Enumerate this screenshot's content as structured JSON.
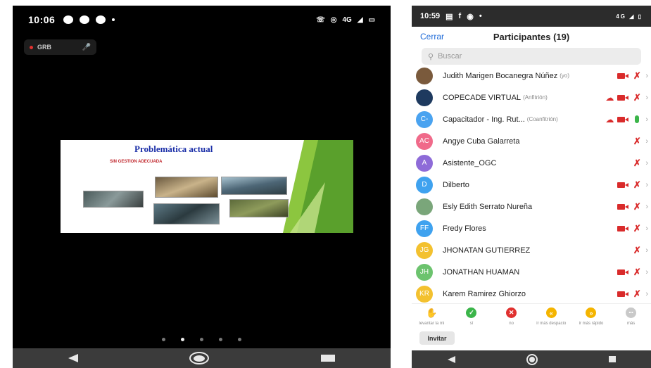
{
  "left_phone": {
    "status": {
      "time": "10:06",
      "network": "4G"
    },
    "recording_label": "GRB",
    "slide": {
      "title": "Problemática actual",
      "subtitle": "SIN GESTION ADECUADA"
    },
    "page_dots": {
      "count": 5,
      "active": 1
    }
  },
  "right_phone": {
    "status": {
      "time": "10:59",
      "network": "4G"
    },
    "header": {
      "close_label": "Cerrar",
      "title": "Participantes (19)"
    },
    "search": {
      "placeholder": "Buscar"
    },
    "participants": [
      {
        "name": "Judith Marigen Bocanegra Núñez",
        "tag": "(yo)",
        "avatar_initials": "",
        "avatar_color": "#7a5a3c",
        "icons": [
          "video-off",
          "mic-off"
        ]
      },
      {
        "name": "COPECADE VIRTUAL",
        "tag": "(Anfitrión)",
        "avatar_initials": "",
        "avatar_color": "#1e3a5f",
        "icons": [
          "cloud",
          "video-off",
          "mic-off"
        ]
      },
      {
        "name": "Capacitador - Ing. Rut...",
        "tag": "(Coanfitrión)",
        "avatar_initials": "C-",
        "avatar_color": "#4aa3f0",
        "icons": [
          "cloud",
          "video-off",
          "mic-on"
        ]
      },
      {
        "name": "Angye Cuba Galarreta",
        "tag": "",
        "avatar_initials": "AC",
        "avatar_color": "#f06a8a",
        "icons": [
          "mic-off"
        ]
      },
      {
        "name": "Asistente_OGC",
        "tag": "",
        "avatar_initials": "A",
        "avatar_color": "#8e6bd8",
        "icons": [
          "mic-off"
        ]
      },
      {
        "name": "Dilberto",
        "tag": "",
        "avatar_initials": "D",
        "avatar_color": "#3fa2ef",
        "icons": [
          "video-off",
          "mic-off"
        ]
      },
      {
        "name": "Esly Edith Serrato Nureña",
        "tag": "",
        "avatar_initials": "",
        "avatar_color": "#7aa67a",
        "icons": [
          "video-off",
          "mic-off"
        ]
      },
      {
        "name": "Fredy Flores",
        "tag": "",
        "avatar_initials": "FF",
        "avatar_color": "#3fa2ef",
        "icons": [
          "video-off",
          "mic-off"
        ]
      },
      {
        "name": "JHONATAN GUTIERREZ",
        "tag": "",
        "avatar_initials": "JG",
        "avatar_color": "#f3c12f",
        "icons": [
          "mic-off"
        ]
      },
      {
        "name": "JONATHAN HUAMAN",
        "tag": "",
        "avatar_initials": "JH",
        "avatar_color": "#6cc36e",
        "icons": [
          "video-off",
          "mic-off"
        ]
      },
      {
        "name": "Karem Ramirez Ghiorzo",
        "tag": "",
        "avatar_initials": "KR",
        "avatar_color": "#f3c12f",
        "icons": [
          "video-off",
          "mic-off"
        ]
      }
    ],
    "actions": [
      {
        "label": "levantar la mi",
        "icon": "hand-icon",
        "color": "#2b63d9",
        "glyph": "✋"
      },
      {
        "label": "sí",
        "icon": "check-icon",
        "color": "#3bb54a",
        "glyph": "✓"
      },
      {
        "label": "no",
        "icon": "x-icon",
        "color": "#e0312f",
        "glyph": "✕"
      },
      {
        "label": "ir más despacio",
        "icon": "rewind-icon",
        "color": "#f4b400",
        "glyph": "«"
      },
      {
        "label": "ir más rápido",
        "icon": "fast-forward-icon",
        "color": "#f4b400",
        "glyph": "»"
      },
      {
        "label": "más",
        "icon": "more-icon",
        "color": "#c9c9c9",
        "glyph": "•••"
      }
    ],
    "invite_label": "Invitar"
  }
}
